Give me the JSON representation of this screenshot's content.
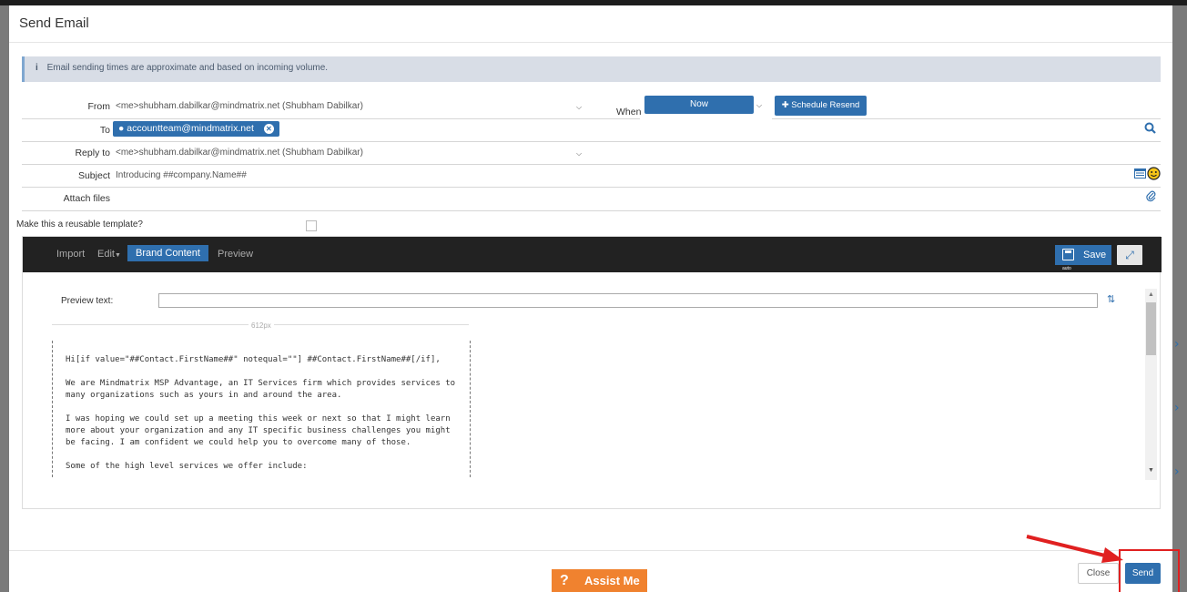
{
  "dialog": {
    "title": "Send Email"
  },
  "info": {
    "icon": "info-icon",
    "message": "Email sending times are approximate and based on incoming volume."
  },
  "form": {
    "from_label": "From",
    "from_value": "<me>shubham.dabilkar@mindmatrix.net (Shubham Dabilkar)",
    "when_label": "When",
    "when_value": "Now",
    "schedule_label": "Schedule Resend",
    "to_label": "To",
    "to_chip": "accountteam@mindmatrix.net",
    "reply_label": "Reply to",
    "reply_value": "<me>shubham.dabilkar@mindmatrix.net (Shubham Dabilkar)",
    "subject_label": "Subject",
    "subject_value": "Introducing ##company.Name##",
    "attach_label": "Attach files",
    "template_label": "Make this a reusable template?"
  },
  "editor": {
    "tabs": [
      "Import",
      "Edit",
      "Brand Content",
      "Preview"
    ],
    "active_tab": "Brand Content",
    "save_label": "Save",
    "save_sub": "auto",
    "preview_text_label": "Preview text:",
    "preview_text_value": "",
    "width_label": "612px",
    "body": [
      "Hi[if value=\"##Contact.FirstName##\" notequal=\"\"] ##Contact.FirstName##[/if],",
      "We are Mindmatrix MSP Advantage, an IT Services firm which provides services to many organizations such as yours in and around the area.",
      "I was hoping we could set up a meeting this week or next so that I might learn more about your organization and any IT specific business challenges you might be facing. I am confident we could help you to overcome many of those.",
      "Some of the high level services we offer include:"
    ]
  },
  "footer": {
    "assist_label": "Assist Me",
    "close_label": "Close",
    "send_label": "Send"
  },
  "colors": {
    "primary": "#2f6fae",
    "toolbar": "#222222",
    "assist": "#f0822f",
    "annotation": "#e02020"
  }
}
